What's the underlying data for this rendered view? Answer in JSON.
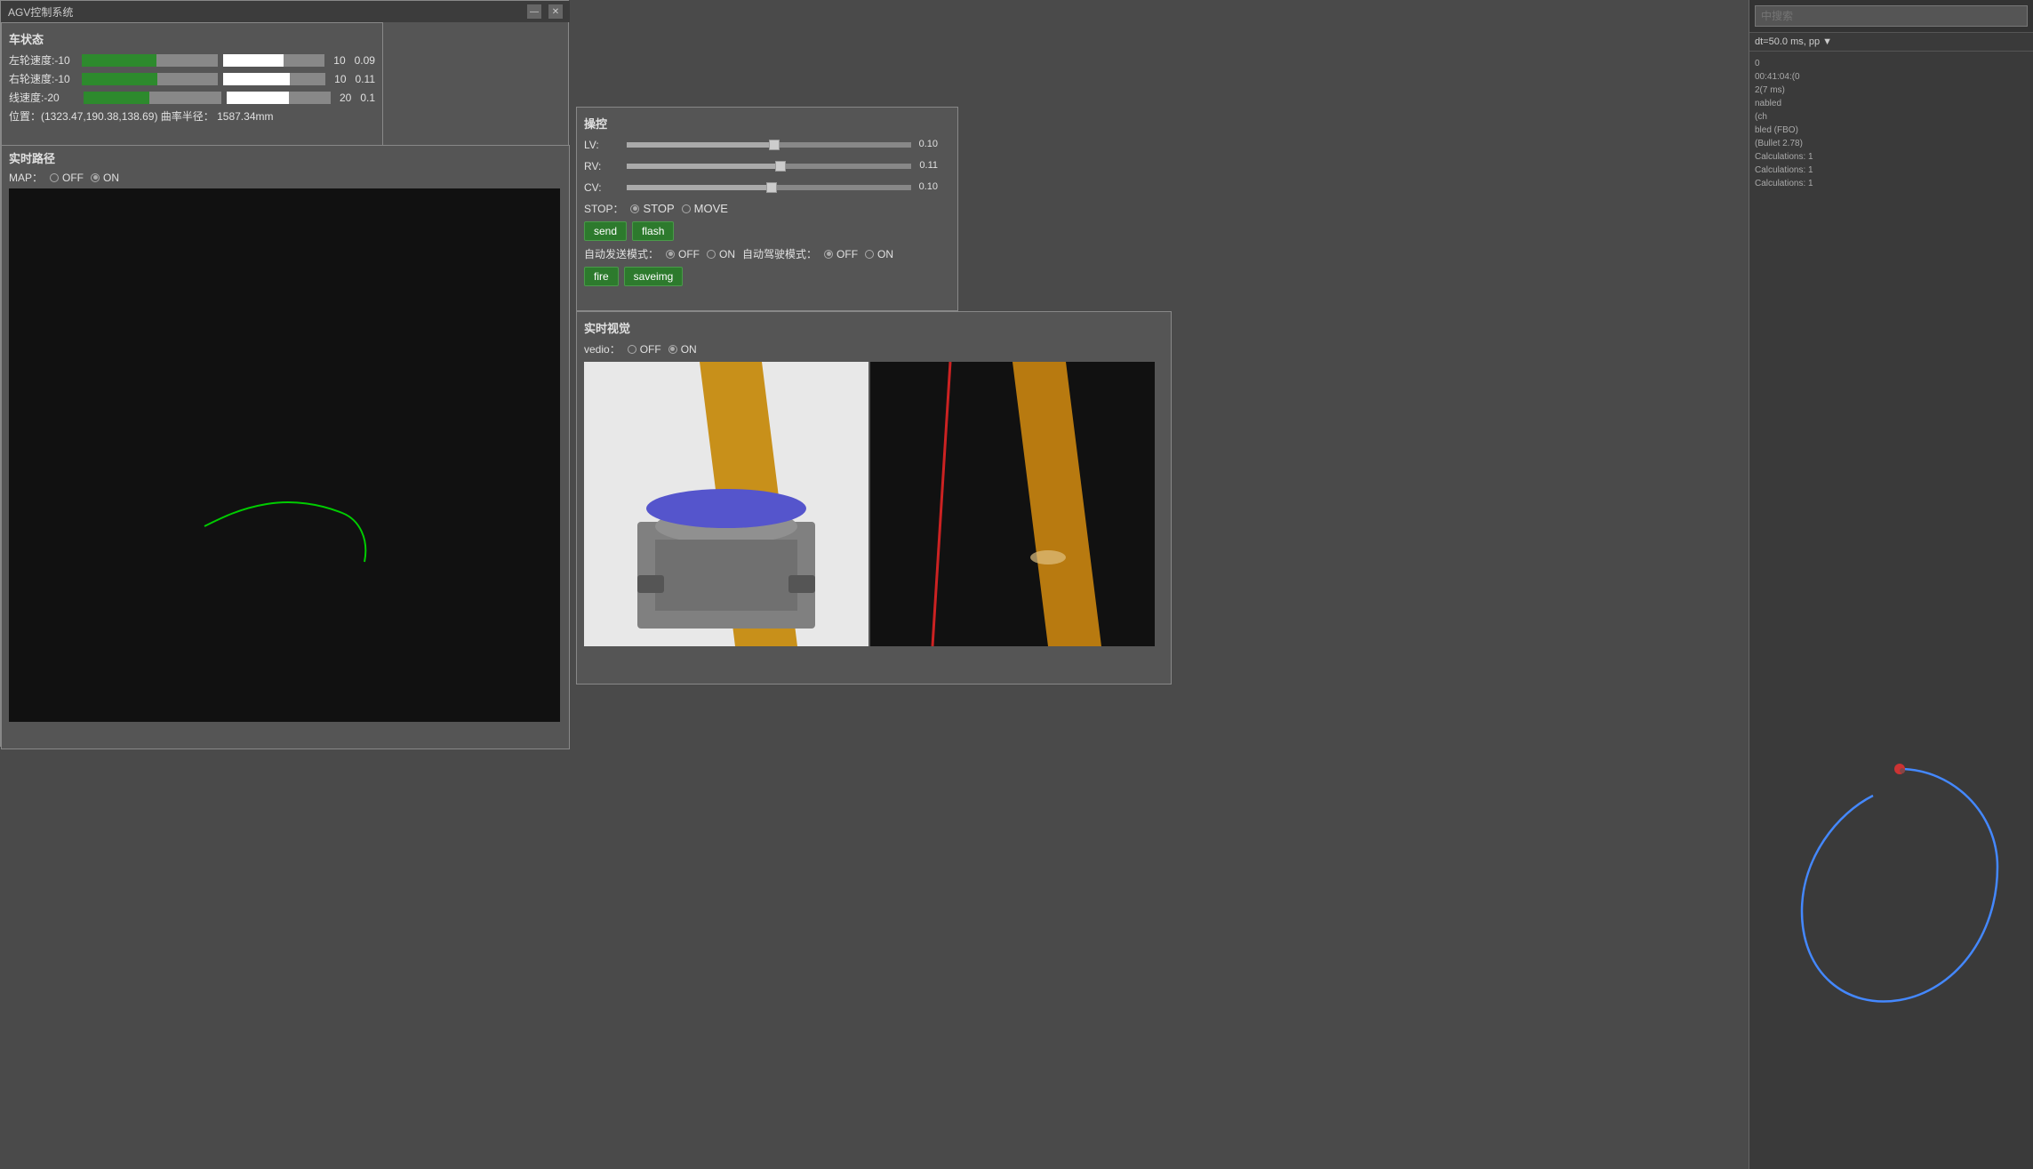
{
  "window": {
    "title": "AGV控制系统",
    "minimize_label": "—",
    "close_label": "✕"
  },
  "car_status": {
    "title": "车状态",
    "rows": [
      {
        "label": "左轮速度:-10",
        "value1": "10",
        "value2": "0.09",
        "fill_pct": 55
      },
      {
        "label": "右轮速度:-10",
        "value1": "10",
        "value2": "0.11",
        "fill_pct": 55
      },
      {
        "label": "线速度:-20",
        "value1": "20",
        "value2": "0.1",
        "fill_pct": 48
      }
    ],
    "position_label": "位置：(1323.47,190.38,138.69)  曲率半径：  1587.34mm"
  },
  "realtime_path": {
    "title": "实时路径",
    "map_label": "MAP：",
    "off_label": "OFF",
    "on_label": "ON"
  },
  "control": {
    "title": "操控",
    "lv_label": "LV:",
    "lv_value": "0.10",
    "lv_pct": 52,
    "rv_label": "RV:",
    "rv_value": "0.11",
    "rv_pct": 54,
    "cv_label": "CV:",
    "cv_value": "0.10",
    "cv_pct": 51,
    "stop_label": "STOP：",
    "stop_option": "STOP",
    "move_option": "MOVE",
    "send_btn": "send",
    "flash_btn": "flash",
    "auto_send_label": "自动发送模式：",
    "auto_send_off": "OFF",
    "auto_send_on": "ON",
    "auto_drive_label": "自动驾驶模式：",
    "auto_drive_off": "OFF",
    "auto_drive_on": "ON",
    "fire_btn": "fire",
    "saveimg_btn": "saveimg"
  },
  "video": {
    "title": "实时视觉",
    "vedio_label": "vedio：",
    "off_label": "OFF",
    "on_label": "ON"
  },
  "right_panel": {
    "search_placeholder": "中搜索",
    "toolbar_text": "dt=50.0 ms, pp ▼",
    "log_lines": [
      "0",
      "00:41:04:(0",
      "2(7 ms)",
      "nabled",
      "(ch",
      "bled (FBO)",
      "(Bullet 2.78)",
      "Calculations: 1",
      "Calculations: 1",
      "Calculations: 1"
    ]
  }
}
